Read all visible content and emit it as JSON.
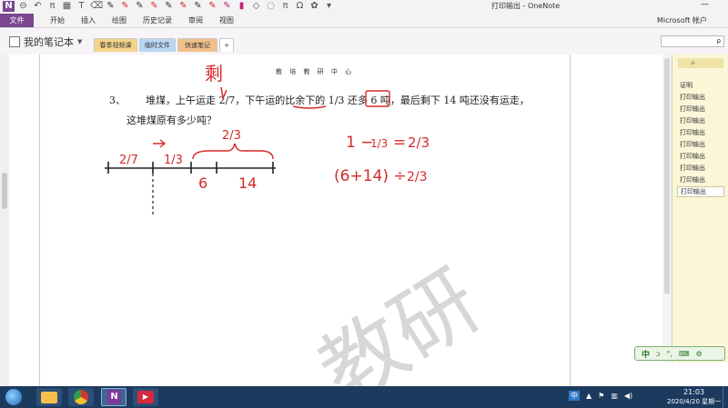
{
  "window": {
    "title": "打印输出 - OneNote",
    "user": "Microsoft 帐户"
  },
  "ribbon": {
    "file_tab": "文件",
    "tabs": [
      "开始",
      "插入",
      "绘图",
      "历史记录",
      "审阅",
      "视图"
    ],
    "quick_access_icons": [
      "onenote-icon",
      "back-icon",
      "undo-icon",
      "pi-icon",
      "table-icon",
      "text-icon",
      "eraser-icon",
      "pen-icon"
    ]
  },
  "notebook": {
    "name": "我的笔记本",
    "sections": [
      "春季视频课",
      "临时文件",
      "快速笔记"
    ],
    "add_section": "+"
  },
  "search": {
    "placeholder": "ρ"
  },
  "document": {
    "header": "教 培 教 研 中 心",
    "question_number": "3、",
    "line1": "堆煤，上午运走 2/7，下午运的比余下的 1/3 还多 6 吨，最后剩下 14 吨还没有运走，",
    "line2": "这堆煤原有多少吨？",
    "watermark": "教研"
  },
  "handwriting": {
    "label_top": "剩",
    "segment_a": "2/7",
    "segment_b": "1/3",
    "bracket_label": "2/3",
    "seg_6": "6",
    "seg_14": "14",
    "eq1_left": "1 −",
    "eq1_mid": "1/3",
    "eq1_eq": "=",
    "eq1_right": "2/3",
    "eq2": "(6+14) ÷",
    "eq2_frac": "2/3"
  },
  "pages_panel": {
    "items": [
      "证明",
      "打印输出",
      "打印输出",
      "打印输出",
      "打印输出",
      "打印输出",
      "打印输出",
      "打印输出",
      "打印输出",
      "打印输出"
    ]
  },
  "ime_toolbar": {
    "lang": "中",
    "items": [
      "ↄ",
      "°,",
      "⌨",
      "⚙"
    ]
  },
  "taskbar": {
    "tray_ime": "中",
    "clock_time": "21:03",
    "clock_date": "2020/4/20 星期一"
  },
  "colors": {
    "ink": "#d42a2a",
    "onenote_purple": "#7a4790",
    "panel_yellow": "#fbf6d8",
    "taskbar": "#1b3a5e"
  }
}
